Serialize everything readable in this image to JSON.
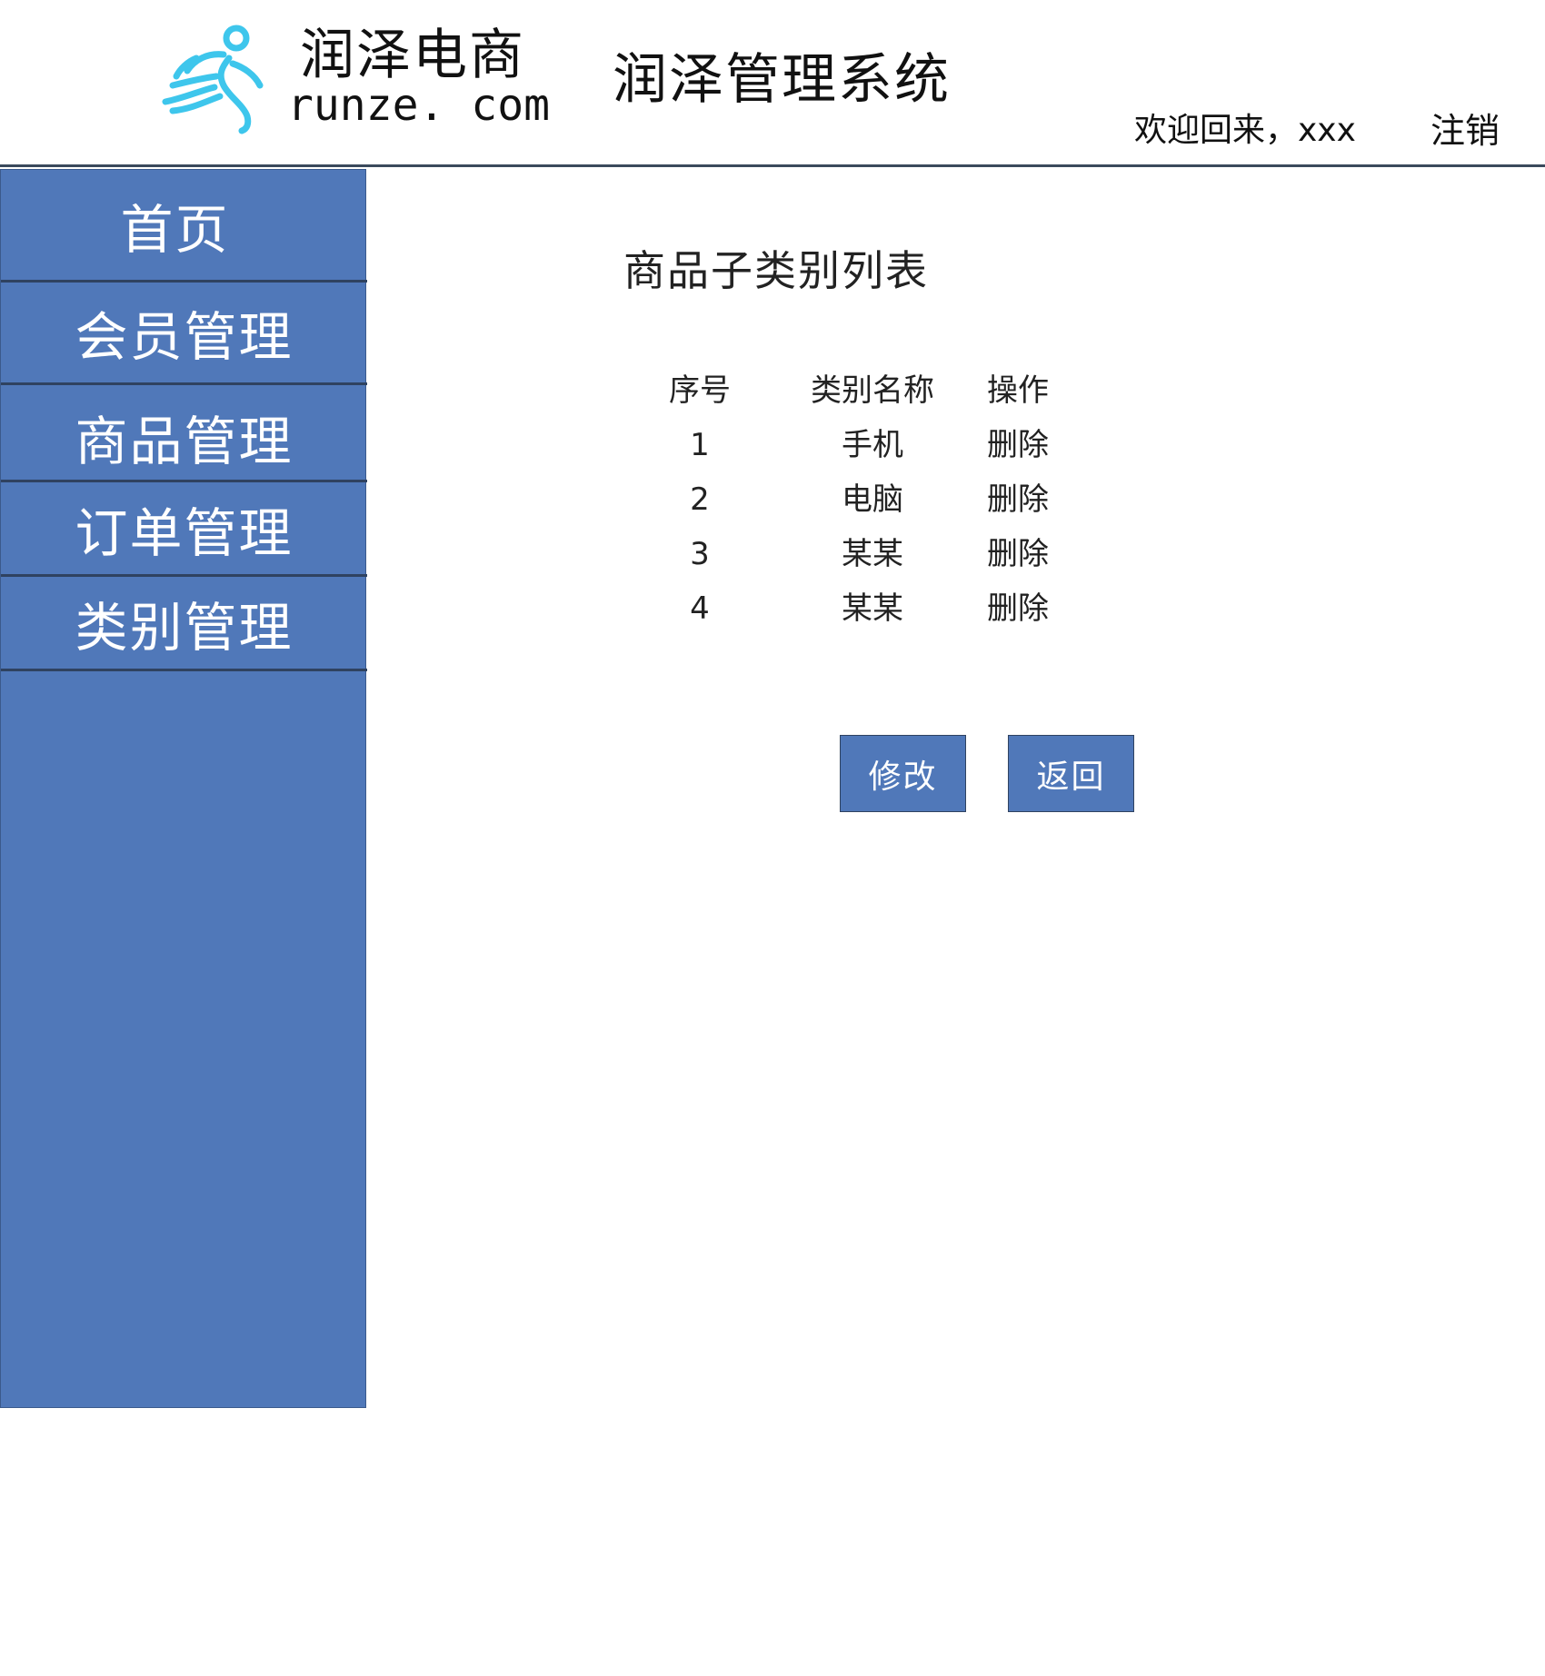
{
  "header": {
    "logo_cn": "润泽电商",
    "logo_en": "runze. com",
    "logo_icon": "running-person-logo",
    "app_title": "润泽管理系统",
    "welcome_text": "欢迎回来，xxx",
    "logout_label": "注销"
  },
  "sidebar": {
    "items": [
      {
        "label": "首页"
      },
      {
        "label": "会员管理"
      },
      {
        "label": "商品管理"
      },
      {
        "label": "订单管理"
      },
      {
        "label": "类别管理"
      }
    ]
  },
  "main": {
    "title": "商品子类别列表",
    "table": {
      "headers": [
        "序号",
        "类别名称",
        "操作"
      ],
      "rows": [
        {
          "seq": "1",
          "name": "手机",
          "op": "删除"
        },
        {
          "seq": "2",
          "name": "电脑",
          "op": "删除"
        },
        {
          "seq": "3",
          "name": "某某",
          "op": "删除"
        },
        {
          "seq": "4",
          "name": "某某",
          "op": "删除"
        }
      ]
    },
    "buttons": {
      "edit_label": "修改",
      "back_label": "返回"
    }
  },
  "colors": {
    "sidebar_bg": "#5078b9",
    "sidebar_divider": "#2f4260",
    "logo_cyan": "#3ec6ec",
    "button_bg": "#5078b9"
  }
}
